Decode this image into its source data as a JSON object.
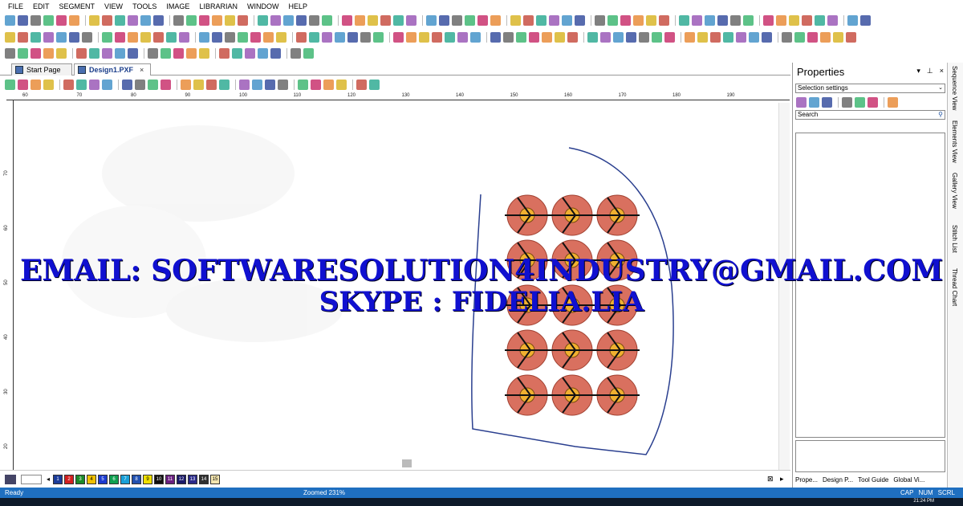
{
  "menu": [
    "FILE",
    "EDIT",
    "SEGMENT",
    "VIEW",
    "TOOLS",
    "IMAGE",
    "LIBRARIAN",
    "WINDOW",
    "HELP"
  ],
  "tabs": [
    {
      "label": "Start Page",
      "active": false
    },
    {
      "label": "Design1.PXF",
      "active": true,
      "close": "×"
    }
  ],
  "ruler": {
    "h_ticks": [
      "60",
      "70",
      "80",
      "90",
      "100",
      "110",
      "120",
      "130",
      "140",
      "150",
      "160",
      "170",
      "180",
      "190"
    ],
    "v_ticks": [
      "70",
      "60",
      "50",
      "40",
      "30",
      "20"
    ]
  },
  "color_swatches": [
    {
      "n": "1",
      "color": "#1b3c9a"
    },
    {
      "n": "2",
      "color": "#d32020"
    },
    {
      "n": "3",
      "color": "#1a8a2a"
    },
    {
      "n": "4",
      "color": "#f0c000"
    },
    {
      "n": "5",
      "color": "#1a3ad0"
    },
    {
      "n": "6",
      "color": "#10a050"
    },
    {
      "n": "7",
      "color": "#18a0d8"
    },
    {
      "n": "8",
      "color": "#2050b0"
    },
    {
      "n": "9",
      "color": "#f0e000"
    },
    {
      "n": "10",
      "color": "#101010"
    },
    {
      "n": "11",
      "color": "#6a2080"
    },
    {
      "n": "12",
      "color": "#1a1a6a"
    },
    {
      "n": "13",
      "color": "#2a2a8a"
    },
    {
      "n": "14",
      "color": "#303030"
    },
    {
      "n": "15",
      "color": "#f4e6b0"
    }
  ],
  "status": {
    "left": "Ready",
    "middle": "Zoomed 231%",
    "indicators": [
      "CAP",
      "NUM",
      "SCRL"
    ]
  },
  "taskbar": {
    "clock": "21:24 PM"
  },
  "properties": {
    "title": "Properties",
    "controls": [
      "▾",
      "⊥",
      "×"
    ],
    "selection": "Selection settings",
    "search_placeholder": "Search",
    "bottom_tabs": [
      "Prope...",
      "Design P...",
      "Tool Guide",
      "Global Vi..."
    ]
  },
  "side_tabs": [
    "Sequence View",
    "Elements View",
    "Gallery View",
    "Stitch List",
    "Thread Chart"
  ],
  "watermark": {
    "line1": "EMAIL: SOFTWARESOLUTION4INDUSTRY@GMAIL.COM",
    "line2": "SKYPE : FIDELIA.LIA"
  },
  "colors": {
    "status_bar": "#1f6fc0",
    "watermark": "#1010d0",
    "outline": "#2a3f8f",
    "circle_outer": "#d9705f",
    "circle_inner": "#f0b030"
  }
}
